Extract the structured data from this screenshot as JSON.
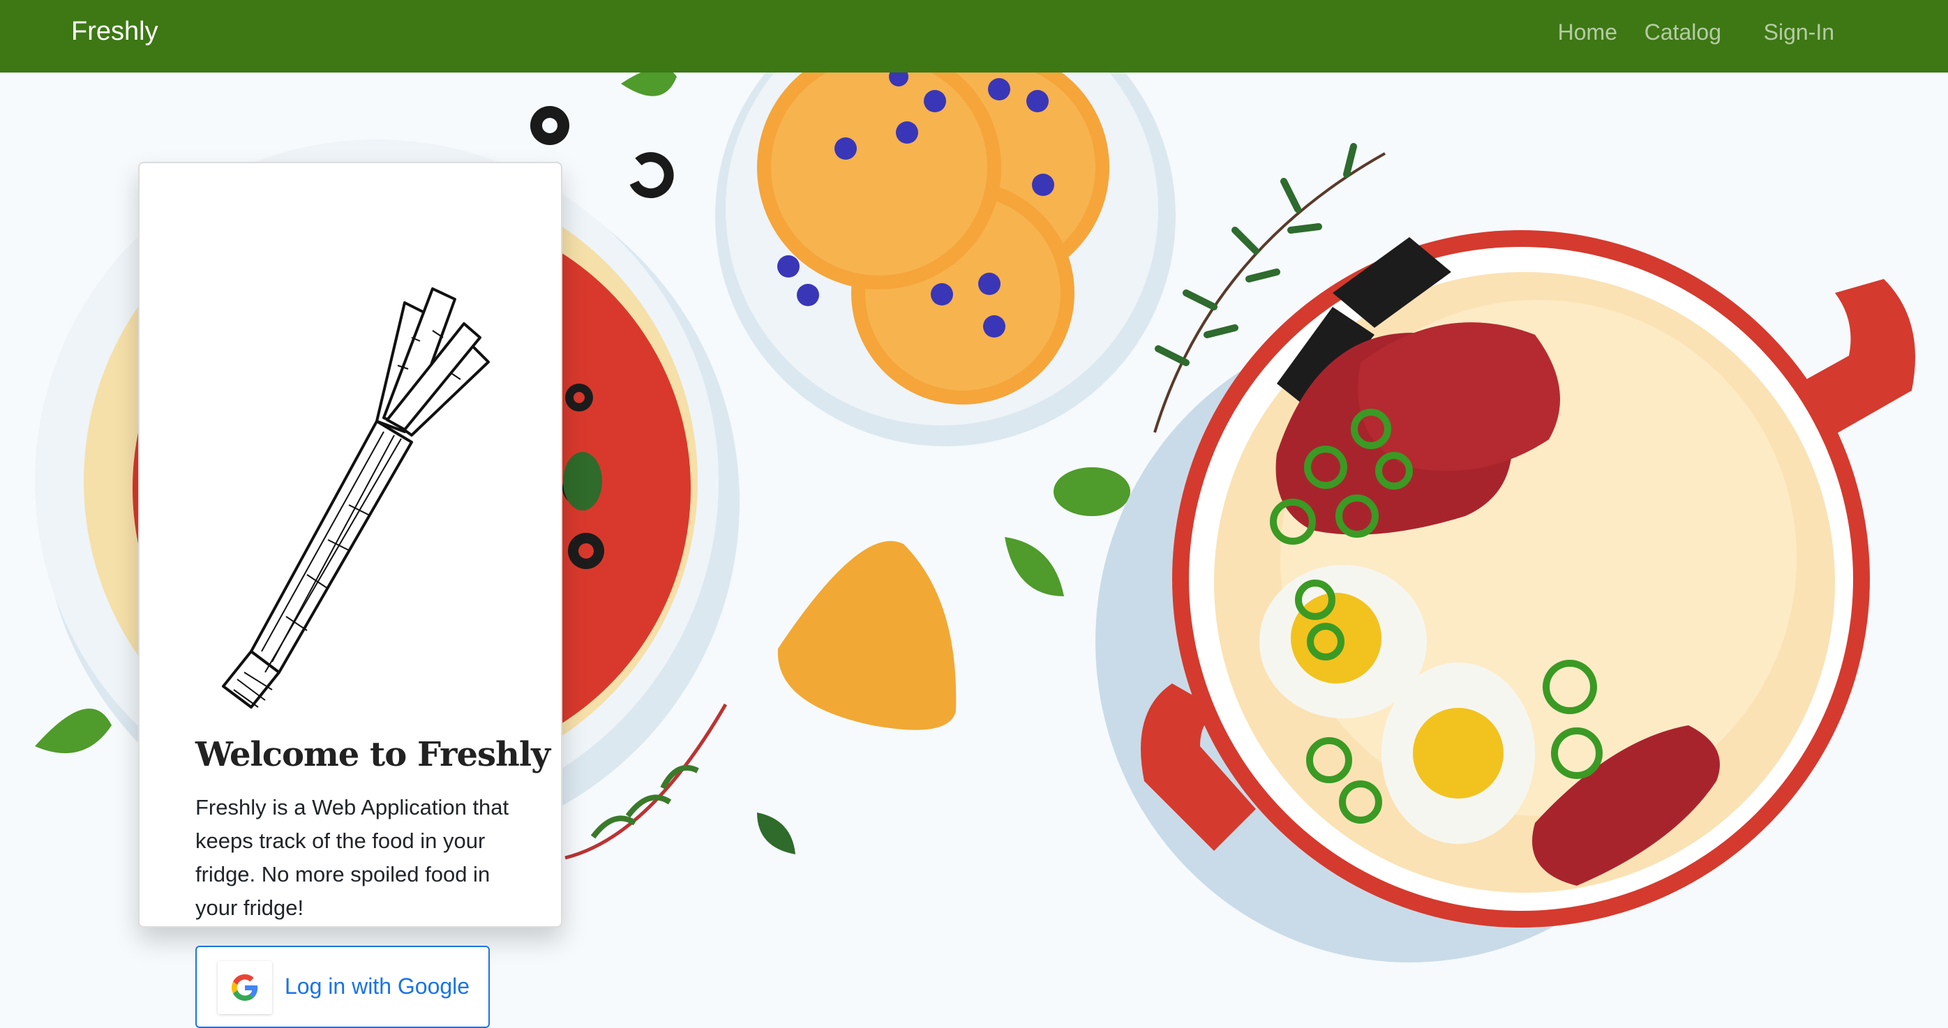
{
  "nav": {
    "brand": "Freshly",
    "links": [
      {
        "label": "Home"
      },
      {
        "label": "Catalog"
      },
      {
        "label": "Sign-In"
      }
    ]
  },
  "card": {
    "title": "Welcome to Freshly",
    "description": "Freshly is a Web Application that keeps track of the food in your fridge. No more spoiled food in your fridge!",
    "login_button": {
      "label": "Log in with Google",
      "icon": "google-logo-icon"
    }
  },
  "colors": {
    "navbar": "#3d7814",
    "button_accent": "#1a73e8",
    "background": "#f6fafd"
  }
}
